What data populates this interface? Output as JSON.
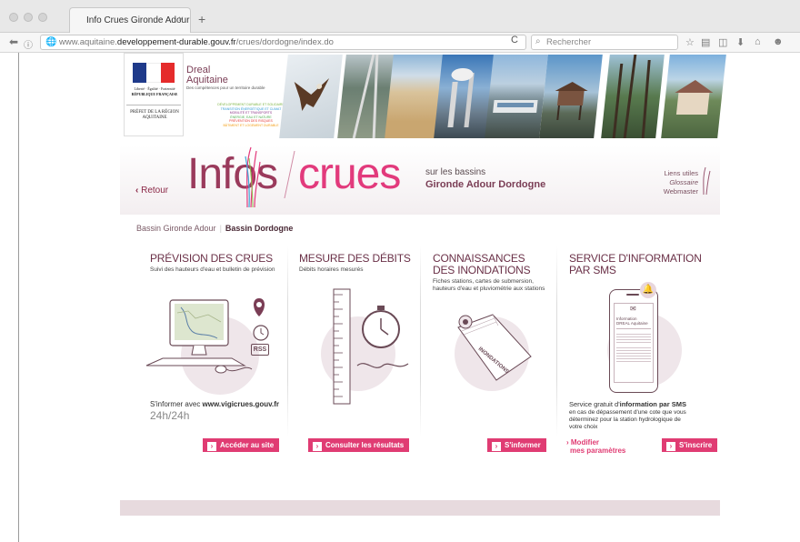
{
  "browser": {
    "tab_title": "Info Crues Gironde Adour D...",
    "tab_close": "×",
    "new_tab": "+",
    "url_prefix": "www.aquitaine.",
    "url_domain": "developpement-durable.gouv.fr",
    "url_path": "/crues/dordogne/index.do",
    "search_placeholder": "Rechercher"
  },
  "banner": {
    "republic_line": "Liberté · Égalité · Fraternité",
    "republic_name": "RÉPUBLIQUE FRANÇAISE",
    "prefet": "PRÉFET DE LA RÉGION AQUITAINE",
    "dreal_name": "Dreal",
    "dreal_region": "Aquitaine",
    "dreal_tagline": "Des compétences pour un territoire durable",
    "dreal_topics": [
      {
        "text": "DÉVELOPPEMENT DURABLE ET SOLIDAIRE",
        "color": "#7cb342"
      },
      {
        "text": "TRANSITION ÉNERGÉTIQUE ET CLIMAT",
        "color": "#2e9bd6"
      },
      {
        "text": "MOBILITÉ ET TRANSPORTS",
        "color": "#8e3a8a"
      },
      {
        "text": "ÉNERGIE, EAU ET NATURE",
        "color": "#4caf50"
      },
      {
        "text": "PRÉVENTION DES RISQUES",
        "color": "#e53935"
      },
      {
        "text": "BÂTIMENT ET LOGEMENT DURABLE",
        "color": "#f39c12"
      }
    ]
  },
  "hero": {
    "retour": "Retour",
    "brand_left": "Infos",
    "brand_right": "crues",
    "sur_les": "sur les bassins",
    "bassins": "Gironde Adour Dordogne",
    "liens_utiles": "Liens utiles",
    "glossaire": "Glossaire",
    "webmaster": "Webmaster"
  },
  "bassin_nav": {
    "item1": "Bassin Gironde Adour",
    "separator": "|",
    "item2": "Bassin Dordogne"
  },
  "columns": {
    "prevision": {
      "title": "PRÉVISION DES CRUES",
      "subtitle": "Suivi des hauteurs d'eau et bulletin de prévision",
      "rss": "RSS",
      "info_prefix": "S'informer avec ",
      "info_site": "www.vigicrues.gouv.fr",
      "hours": "24h/24h",
      "cta": "Accéder au site"
    },
    "mesure": {
      "title": "MESURE DES DÉBITS",
      "subtitle": "Débits horaires mesurés",
      "cta": "Consulter les résultats"
    },
    "connaissances": {
      "title_line1": "CONNAISSANCES",
      "title_line2": "DES INONDATIONS",
      "subtitle": "Fiches stations, cartes de submersion, hauteurs d'eau et pluviométrie aux stations",
      "book_label": "INONDATIONS",
      "cta": "S'informer"
    },
    "sms": {
      "title_line1": "SERVICE D'INFORMATION",
      "title_line2": "PAR SMS",
      "phone_line1": "Information",
      "phone_line2": "DREAL Aquitaine",
      "desc_prefix": "Service gratuit d'",
      "desc_bold": "information par SMS",
      "desc_rest": "en cas de dépassement d'une cote que vous déterminez pour la station hydrologique de votre choix",
      "modifier_line1": "Modifier",
      "modifier_line2": "mes paramètres",
      "cta": "S'inscrire"
    }
  },
  "colors": {
    "accent": "#e03c73",
    "brand_dark": "#9a3a5c",
    "footer": "#e7dade"
  }
}
